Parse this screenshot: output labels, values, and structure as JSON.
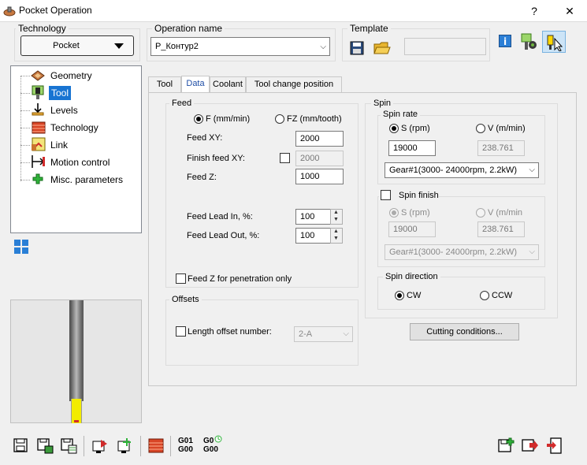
{
  "window": {
    "title": "Pocket Operation",
    "help_button": "?",
    "close_button": "✕"
  },
  "technology": {
    "label": "Technology",
    "value": "Pocket"
  },
  "operation_name": {
    "label": "Operation name",
    "value": "P_Контур2"
  },
  "template": {
    "label": "Template",
    "value": ""
  },
  "tree": {
    "items": [
      {
        "label": "Geometry",
        "icon": "geometry-icon"
      },
      {
        "label": "Tool",
        "icon": "tool-icon"
      },
      {
        "label": "Levels",
        "icon": "levels-icon"
      },
      {
        "label": "Technology",
        "icon": "technology-icon"
      },
      {
        "label": "Link",
        "icon": "link-icon"
      },
      {
        "label": "Motion control",
        "icon": "motion-control-icon"
      },
      {
        "label": "Misc. parameters",
        "icon": "misc-parameters-icon"
      }
    ],
    "selected": "Tool"
  },
  "tabs": [
    {
      "label": "Tool"
    },
    {
      "label": "Data"
    },
    {
      "label": "Coolant"
    },
    {
      "label": "Tool change position"
    }
  ],
  "active_tab": "Data",
  "feed": {
    "title": "Feed",
    "mode_f_label": "F (mm/min)",
    "mode_fz_label": "FZ (mm/tooth)",
    "feed_xy_label": "Feed XY:",
    "feed_xy_value": "2000",
    "finish_feed_xy_label": "Finish feed XY:",
    "finish_feed_xy_value": "2000",
    "feed_z_label": "Feed Z:",
    "feed_z_value": "1000",
    "lead_in_label": "Feed Lead In, %:",
    "lead_in_value": "100",
    "lead_out_label": "Feed Lead Out, %:",
    "lead_out_value": "100",
    "penetration_label": "Feed Z for penetration only"
  },
  "offsets": {
    "title": "Offsets",
    "length_offset_label": "Length offset number:",
    "length_offset_value": "2-A"
  },
  "spin": {
    "title": "Spin",
    "rate_title": "Spin rate",
    "s_label": "S (rpm)",
    "v_label": "V (m/min)",
    "s_value": "19000",
    "v_value": "238.761",
    "gear_value": "Gear#1(3000- 24000rpm, 2.2kW)",
    "finish_title": "Spin finish",
    "finish_s_label": "S (rpm)",
    "finish_v_label": "V (m/min",
    "finish_s_value": "19000",
    "finish_v_value": "238.761",
    "finish_gear_value": "Gear#1(3000- 24000rpm, 2.2kW)",
    "direction_title": "Spin direction",
    "cw_label": "CW",
    "ccw_label": "CCW"
  },
  "cutting_conditions_button": "Cutting conditions...",
  "bottom_toolbar": {
    "g01_top": "G01",
    "g01_bottom": "G00",
    "g0_top": "G0",
    "g0_bottom": "G00"
  },
  "colors": {
    "selection": "#1874d2",
    "tab_active_text": "#1f4ea6",
    "tool_tip": "#f2ec00"
  }
}
